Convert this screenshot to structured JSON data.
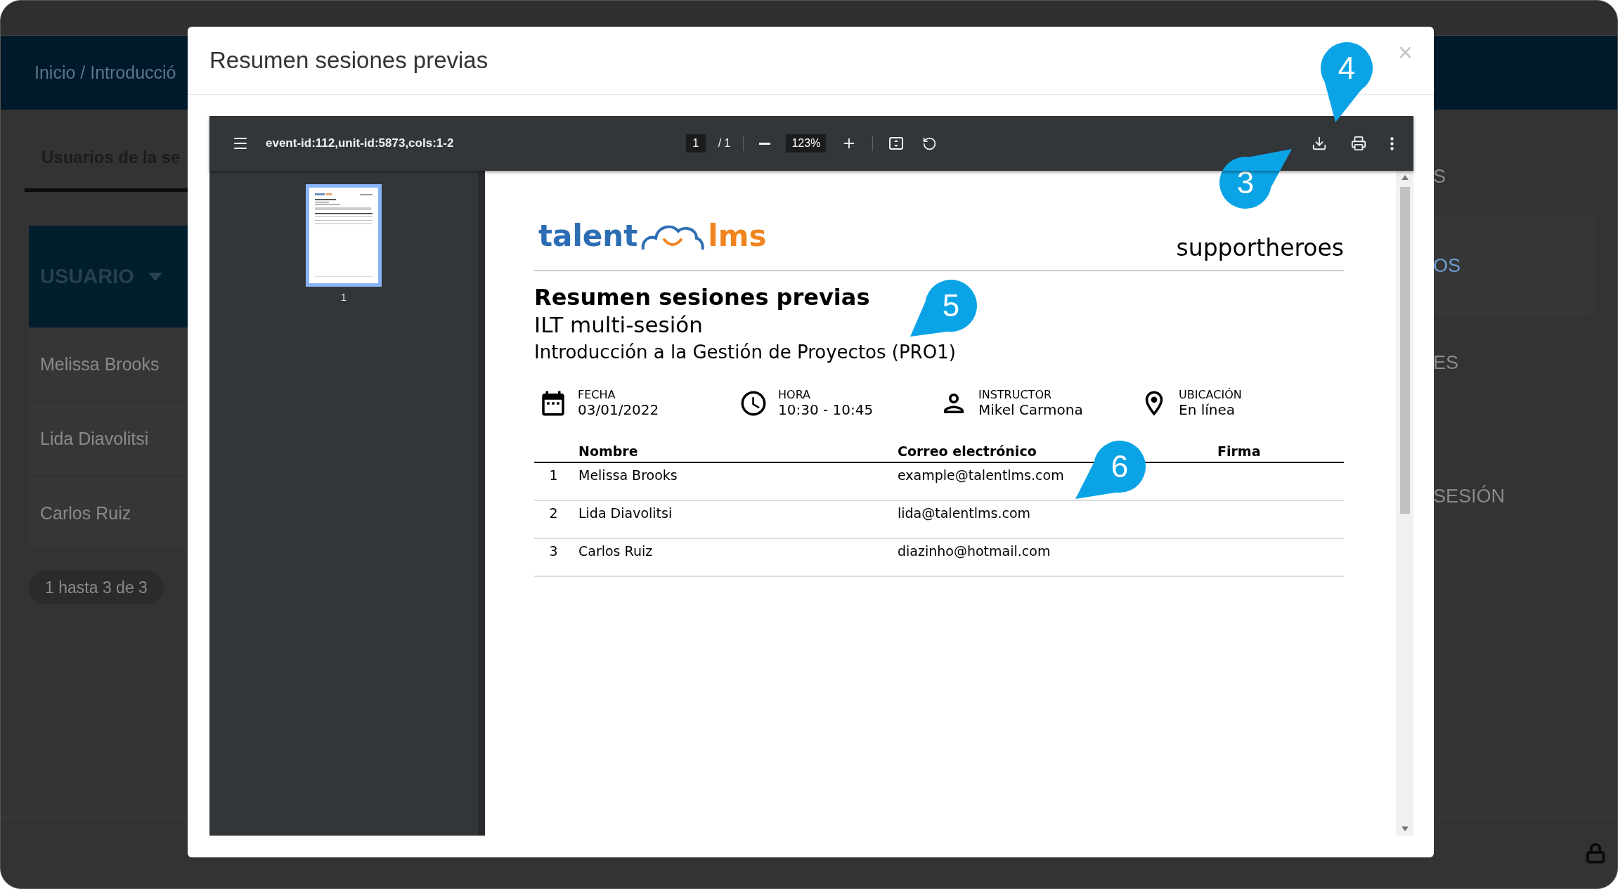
{
  "background": {
    "breadcrumb": "Inicio / Introducció",
    "tab": "Usuarios de la se",
    "table": {
      "column": "USUARIO",
      "rows": [
        "Melissa Brooks",
        "Lida Diavolitsi",
        "Carlos Ruiz"
      ]
    },
    "pagination": "1 hasta 3 de 3",
    "side_items": [
      {
        "label": "S",
        "selected": false
      },
      {
        "label": "OS",
        "selected": true
      },
      {
        "label": "ES",
        "selected": false
      },
      {
        "label": "SESIÓN",
        "selected": false
      }
    ]
  },
  "modal": {
    "title": "Resumen sesiones previas",
    "close": "×",
    "viewer": {
      "file_name": "event-id:112,unit-id:5873,cols:1-2",
      "page": "1",
      "page_total": "/ 1",
      "zoom": "123%",
      "thumbnails": [
        {
          "label": "1",
          "selected": true
        }
      ],
      "document": {
        "brand_left": "talent",
        "brand_right": "lms",
        "account": "supportheroes",
        "title": "Resumen sesiones previas",
        "subtitle": "ILT multi-sesión",
        "course": "Introducción a la Gestión de Proyectos (PRO1)",
        "info": [
          {
            "kind": "date",
            "label": "FECHA",
            "value": "03/01/2022"
          },
          {
            "kind": "time",
            "label": "HORA",
            "value": "10:30 - 10:45"
          },
          {
            "kind": "person",
            "label": "INSTRUCTOR",
            "value": "Mikel Carmona"
          },
          {
            "kind": "location",
            "label": "UBICACIÓN",
            "value": "En línea"
          }
        ],
        "table": {
          "columns": [
            "Nombre",
            "Correo electrónico",
            "Firma"
          ],
          "rows": [
            {
              "number": "1",
              "name": "Melissa Brooks",
              "email": "example@talentlms.com"
            },
            {
              "number": "2",
              "name": "Lida Diavolitsi",
              "email": "lida@talentlms.com"
            },
            {
              "number": "3",
              "name": "Carlos Ruiz",
              "email": "diazinho@hotmail.com"
            }
          ]
        }
      }
    }
  },
  "callouts": [
    {
      "label": "3"
    },
    {
      "label": "4"
    },
    {
      "label": "5"
    },
    {
      "label": "6"
    }
  ]
}
